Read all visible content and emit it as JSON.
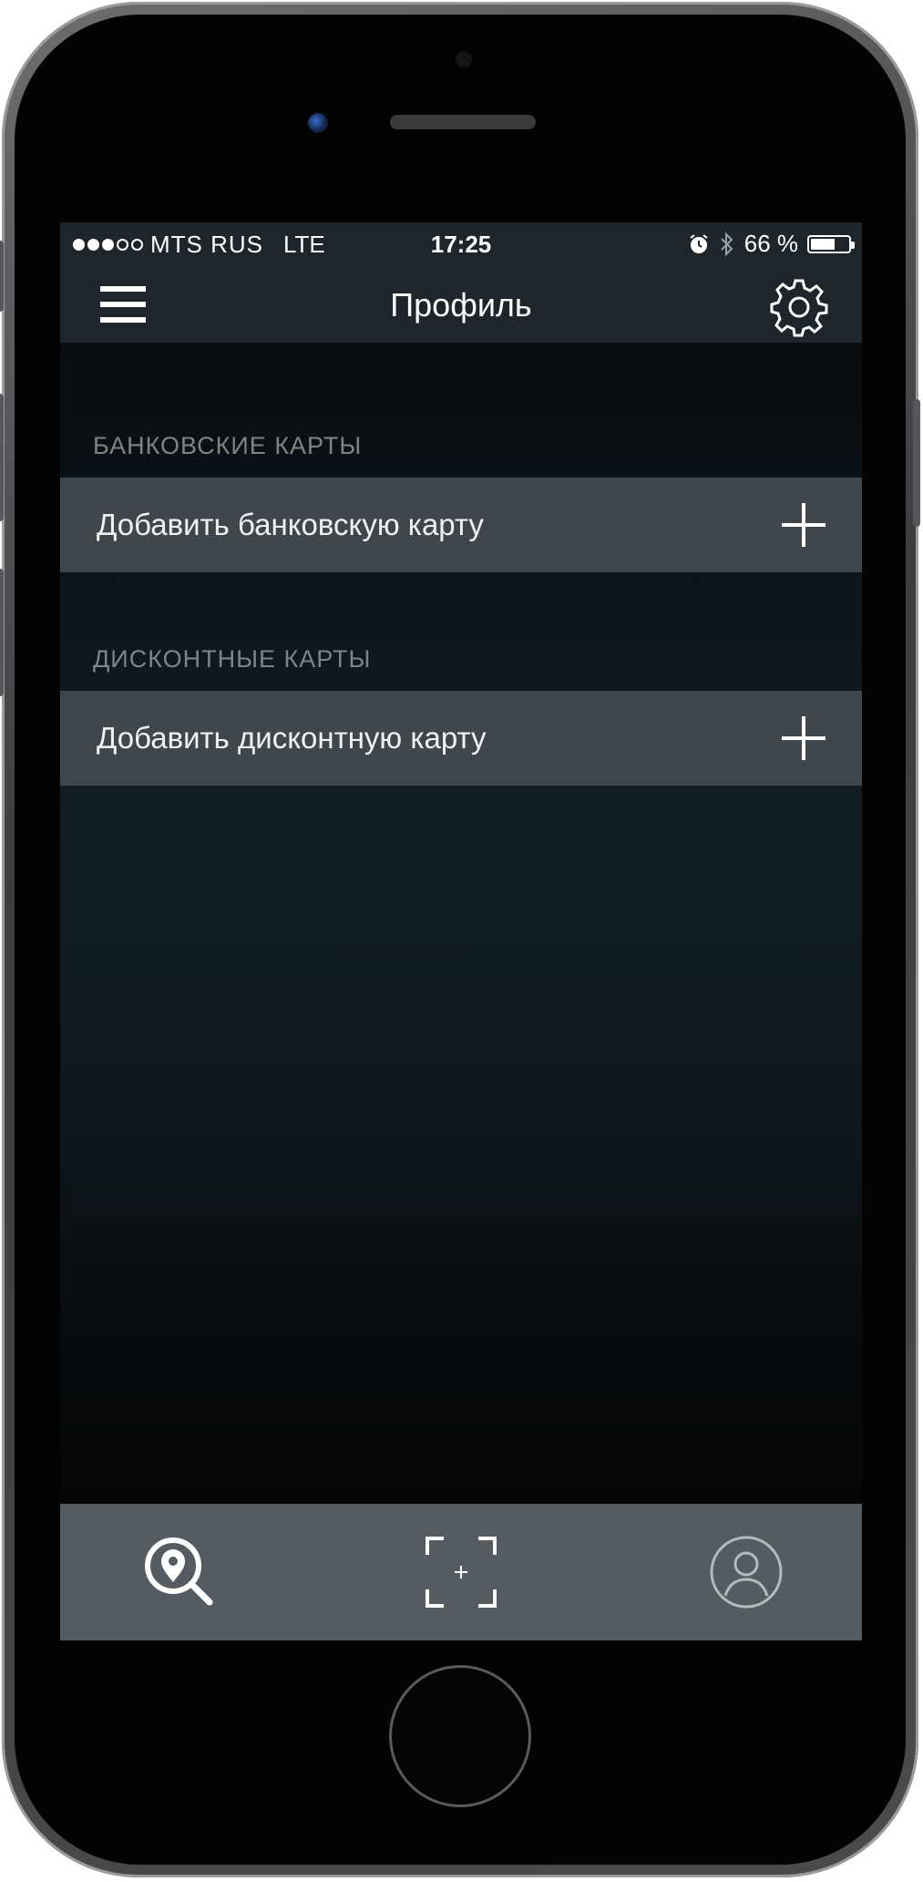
{
  "status_bar": {
    "signal_dots": [
      "filled",
      "filled",
      "filled",
      "empty",
      "empty"
    ],
    "carrier": "MTS RUS",
    "network": "LTE",
    "time": "17:25",
    "alarm_icon": "alarm-icon",
    "bluetooth_icon": "bluetooth-icon",
    "battery_label": "66 %",
    "battery_level": 0.66
  },
  "nav": {
    "title": "Профиль",
    "menu_icon": "hamburger-icon",
    "settings_icon": "gear-icon"
  },
  "sections": [
    {
      "title": "БАНКОВСКИЕ КАРТЫ",
      "row_label": "Добавить банковскую карту",
      "row_icon": "plus-icon"
    },
    {
      "title": "ДИСКОНТНЫЕ КАРТЫ",
      "row_label": "Добавить дисконтную карту",
      "row_icon": "plus-icon"
    }
  ],
  "tabs": [
    {
      "icon": "map-search-icon"
    },
    {
      "icon": "scan-add-icon"
    },
    {
      "icon": "profile-icon"
    }
  ],
  "colors": {
    "bar_bg": "#1f262b",
    "row_bg": "#3f474c",
    "tabbar_bg": "#545c61",
    "section_text": "#7f8488"
  }
}
